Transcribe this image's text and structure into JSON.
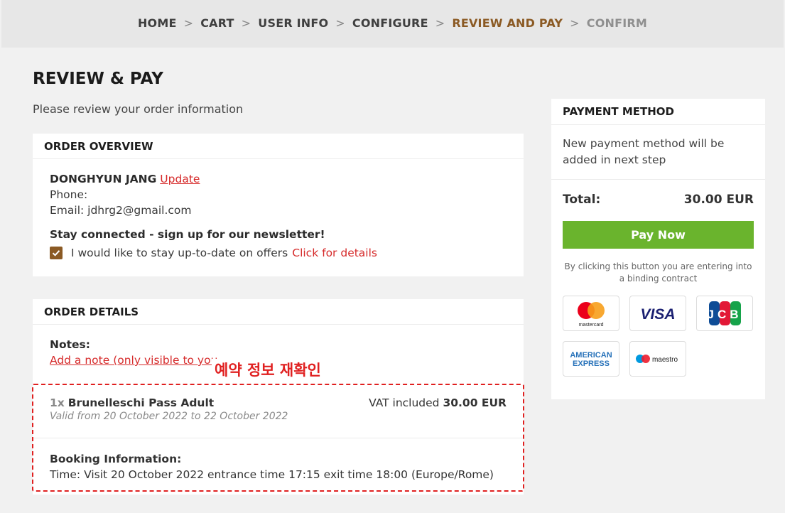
{
  "breadcrumb": {
    "items": [
      {
        "label": "HOME",
        "state": "normal"
      },
      {
        "label": "CART",
        "state": "normal"
      },
      {
        "label": "USER INFO",
        "state": "normal"
      },
      {
        "label": "CONFIGURE",
        "state": "normal"
      },
      {
        "label": "REVIEW AND PAY",
        "state": "active"
      },
      {
        "label": "CONFIRM",
        "state": "disabled"
      }
    ],
    "separator": ">"
  },
  "page": {
    "title": "REVIEW & PAY",
    "subtitle": "Please review your order information"
  },
  "overview": {
    "heading": "ORDER OVERVIEW",
    "name": "DONGHYUN JANG",
    "update_link": "Update",
    "phone": "Phone:",
    "email": "Email: jdhrg2@gmail.com",
    "newsletter_heading": "Stay connected - sign up for our newsletter!",
    "newsletter_label": "I would like to stay up-to-date on offers",
    "newsletter_link": "Click for details",
    "newsletter_checked": true
  },
  "details": {
    "heading": "ORDER DETAILS",
    "notes_label": "Notes:",
    "add_note_link": "Add a note (only visible to you",
    "item": {
      "qty": "1x",
      "name": "Brunelleschi Pass Adult",
      "vat_label": "VAT included",
      "price": "30.00 EUR",
      "validity": "Valid from 20 October 2022 to 22 October 2022"
    },
    "booking_label": "Booking Information:",
    "booking_time": "Time: Visit 20 October 2022 entrance time 17:15 exit time 18:00 (Europe/Rome)"
  },
  "annotation": {
    "text": "예약 정보 재확인",
    "color": "#e02020"
  },
  "payment": {
    "heading": "PAYMENT METHOD",
    "info": "New payment method will be added in next step",
    "total_label": "Total:",
    "total_value": "30.00 EUR",
    "pay_button": "Pay Now",
    "contract_note": "By clicking this button you are entering into a binding contract",
    "logos": [
      {
        "icon": "mastercard-logo-icon",
        "text": "mastercard"
      },
      {
        "icon": "visa-logo-icon",
        "text": "VISA"
      },
      {
        "icon": "jcb-logo-icon",
        "text": "JCB"
      },
      {
        "icon": "amex-logo-icon",
        "text": "AMERICAN EXPRESS"
      },
      {
        "icon": "maestro-logo-icon",
        "text": "maestro"
      }
    ]
  },
  "colors": {
    "accent_brown": "#8b5a24",
    "link_red": "#d62b2b",
    "pay_green": "#6ab42d"
  }
}
